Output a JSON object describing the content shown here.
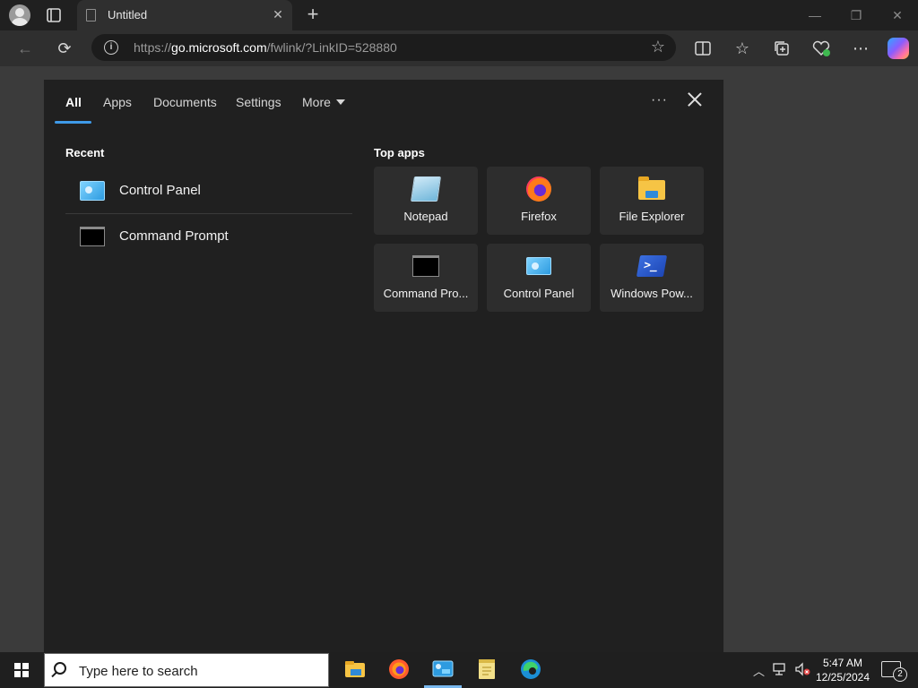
{
  "browser": {
    "tab_title": "Untitled",
    "url_prefix": "https://",
    "url_host": "go.microsoft.com",
    "url_path": "/fwlink/?LinkID=528880",
    "icons": [
      "profile-icon",
      "tab-actions-icon",
      "page-icon",
      "close-icon",
      "plus-icon",
      "minimize-icon",
      "restore-icon",
      "back-icon",
      "refresh-icon",
      "info-icon",
      "star-icon",
      "split-screen-icon",
      "favorites-icon",
      "collections-icon",
      "performance-icon",
      "more-icon",
      "copilot-icon"
    ]
  },
  "search_panel": {
    "tabs": [
      {
        "label": "All",
        "active": true
      },
      {
        "label": "Apps"
      },
      {
        "label": "Documents"
      },
      {
        "label": "Settings"
      },
      {
        "label": "More"
      }
    ],
    "more_options": "···",
    "recent_title": "Recent",
    "recent": [
      {
        "label": "Control Panel",
        "icon": "control-panel-icon"
      },
      {
        "label": "Command Prompt",
        "icon": "command-prompt-icon"
      }
    ],
    "top_apps_title": "Top apps",
    "top_apps": [
      {
        "label": "Notepad",
        "icon": "notepad-icon"
      },
      {
        "label": "Firefox",
        "icon": "firefox-icon"
      },
      {
        "label": "File Explorer",
        "icon": "file-explorer-icon"
      },
      {
        "label": "Command Pro...",
        "icon": "command-prompt-icon"
      },
      {
        "label": "Control Panel",
        "icon": "control-panel-icon"
      },
      {
        "label": "Windows Pow...",
        "icon": "powershell-icon"
      }
    ]
  },
  "taskbar": {
    "search_placeholder": "Type here to search",
    "apps": [
      "file-explorer-icon",
      "firefox-icon",
      "control-panel-icon",
      "notepad-icon",
      "edge-icon"
    ],
    "time": "5:47 AM",
    "date": "12/25/2024",
    "notification_count": "2"
  },
  "colors": {
    "accent": "#3f9ae8",
    "panel_bg": "#202020",
    "tile_bg": "#2d2d2d"
  }
}
